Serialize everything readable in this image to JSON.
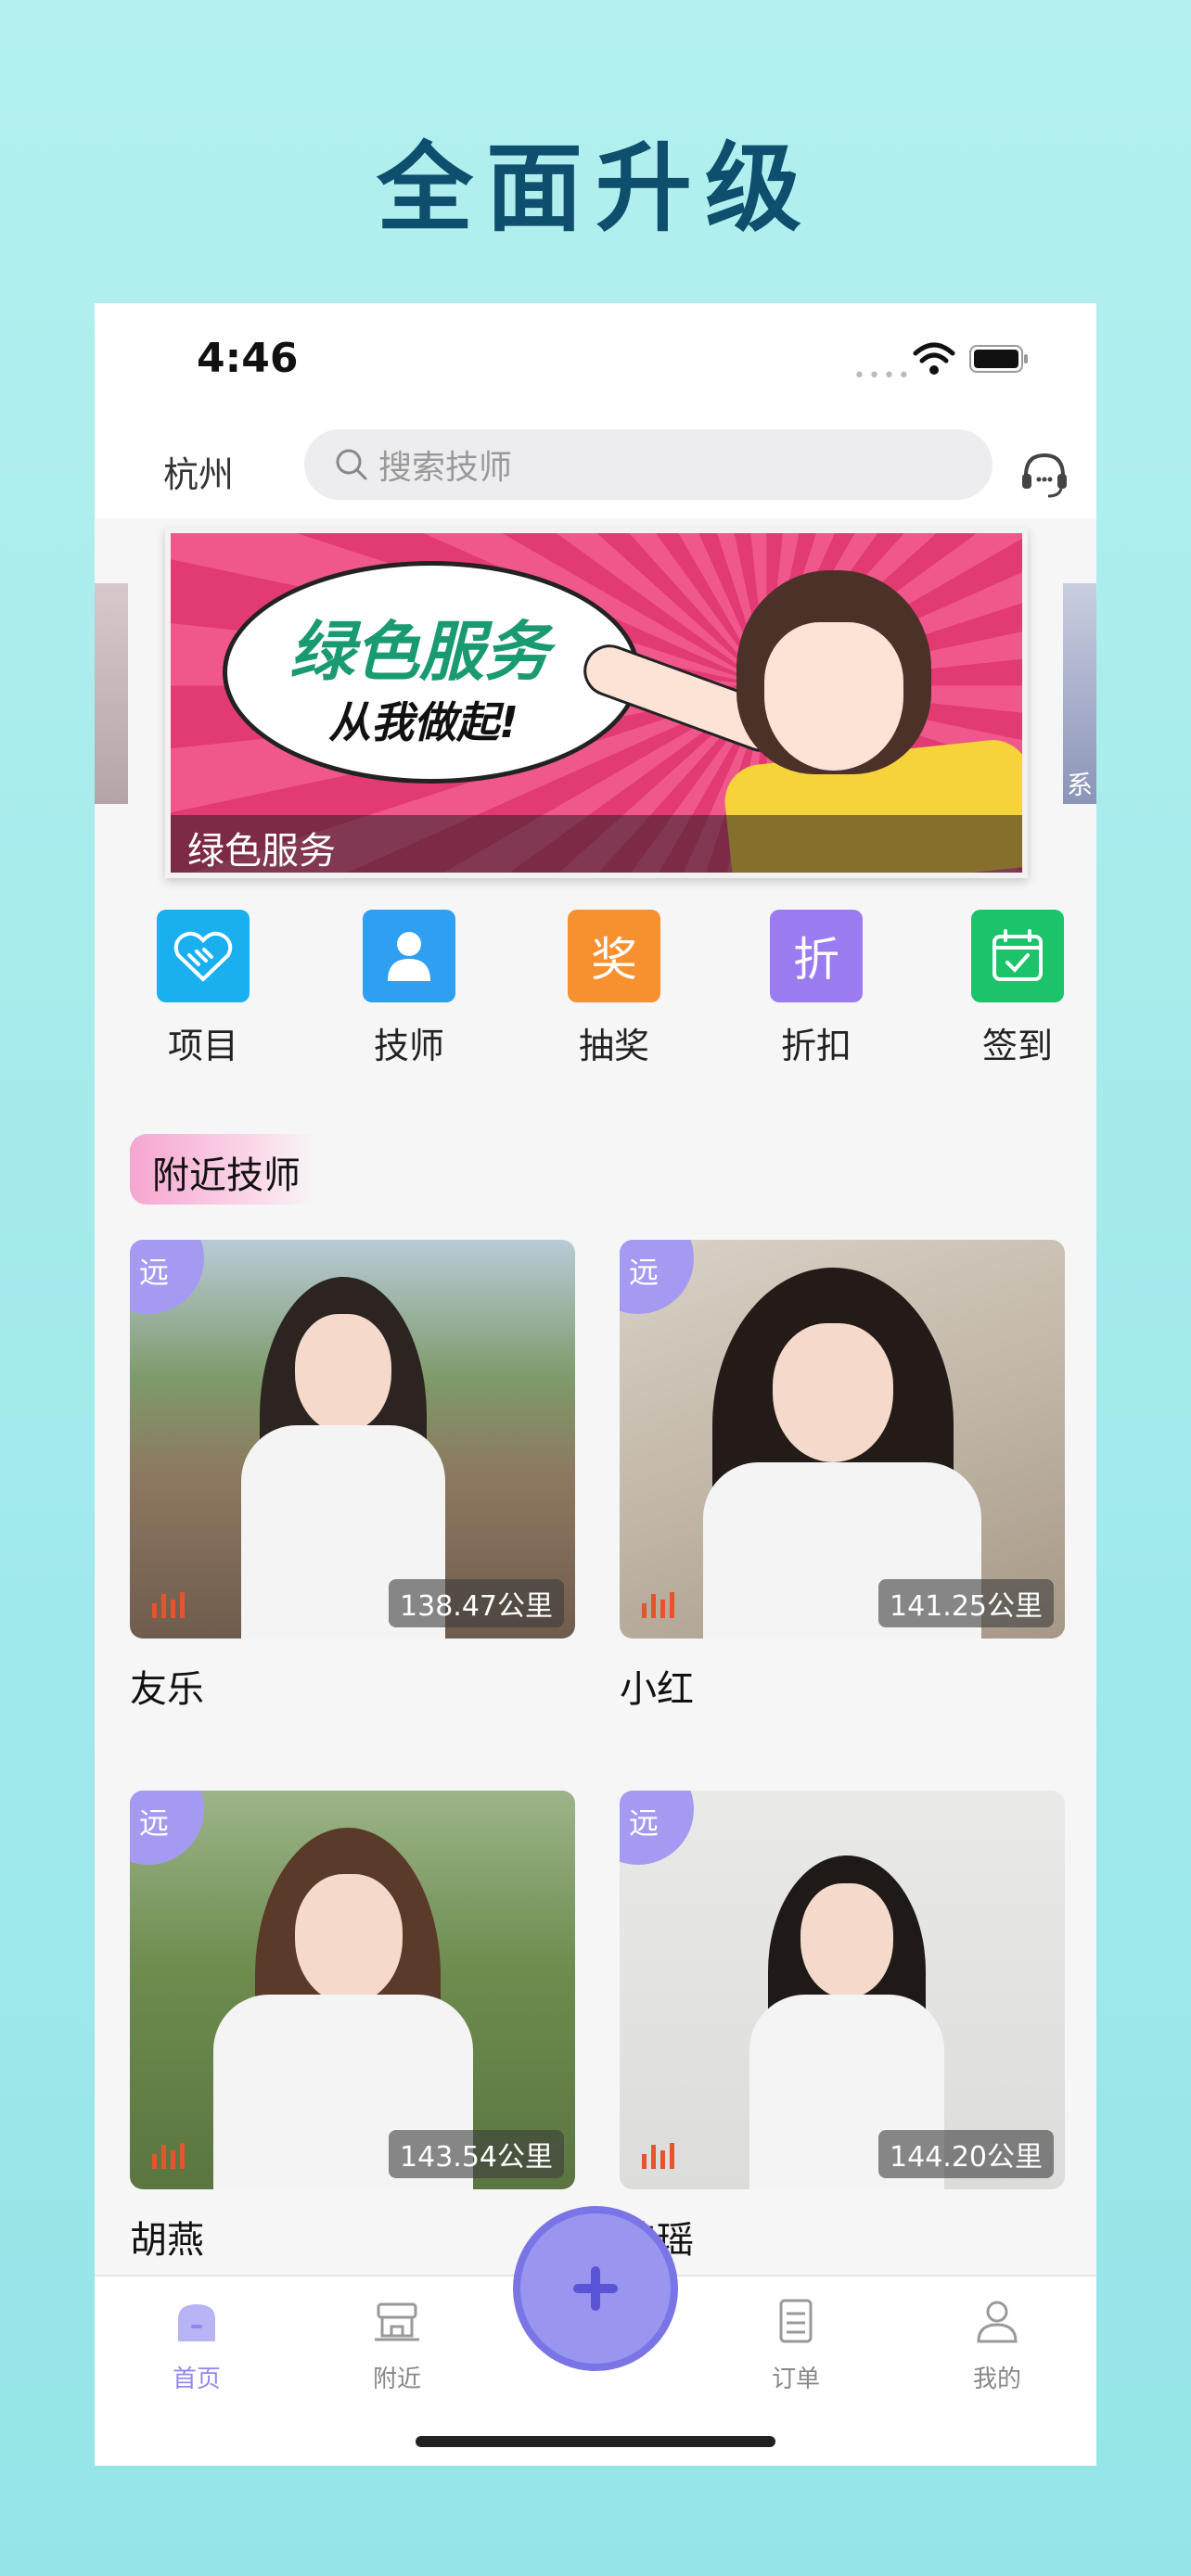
{
  "promo": {
    "headline": "全面升级"
  },
  "status_bar": {
    "time": "4:46"
  },
  "topbar": {
    "city": "杭州",
    "search_placeholder": "搜索技师"
  },
  "banner": {
    "caption": "绿色服务",
    "title": "绿色服务",
    "subtitle": "从我做起!",
    "side_right_text": "系"
  },
  "menu": [
    {
      "label": "项目",
      "icon": "handshake-icon",
      "color": "#1ab0f0"
    },
    {
      "label": "技师",
      "icon": "person-icon",
      "color": "#2f9ff2"
    },
    {
      "label": "抽奖",
      "icon": "lottery-icon",
      "glyph": "奖",
      "color": "#f7902f"
    },
    {
      "label": "折扣",
      "icon": "discount-icon",
      "glyph": "折",
      "color": "#9b7bf0"
    },
    {
      "label": "签到",
      "icon": "calendar-check-icon",
      "color": "#1bc46a"
    }
  ],
  "section": {
    "title": "附近技师"
  },
  "therapists": [
    {
      "name": "友乐",
      "badge": "远",
      "distance": "138.47公里"
    },
    {
      "name": "小红",
      "badge": "远",
      "distance": "141.25公里"
    },
    {
      "name": "胡燕",
      "badge": "远",
      "distance": "143.54公里"
    },
    {
      "name": "佳瑶",
      "badge": "远",
      "distance": "144.20公里"
    }
  ],
  "tabbar": {
    "items": [
      {
        "label": "首页",
        "icon": "home-icon",
        "active": true
      },
      {
        "label": "附近",
        "icon": "nearby-icon",
        "active": false
      },
      {
        "label": "订单",
        "icon": "order-icon",
        "active": false
      },
      {
        "label": "我的",
        "icon": "profile-icon",
        "active": false
      }
    ],
    "fab_icon": "plus-icon"
  },
  "colors": {
    "accent": "#8f89ee",
    "headline": "#0d4f6d",
    "background": "#a8ecec"
  }
}
